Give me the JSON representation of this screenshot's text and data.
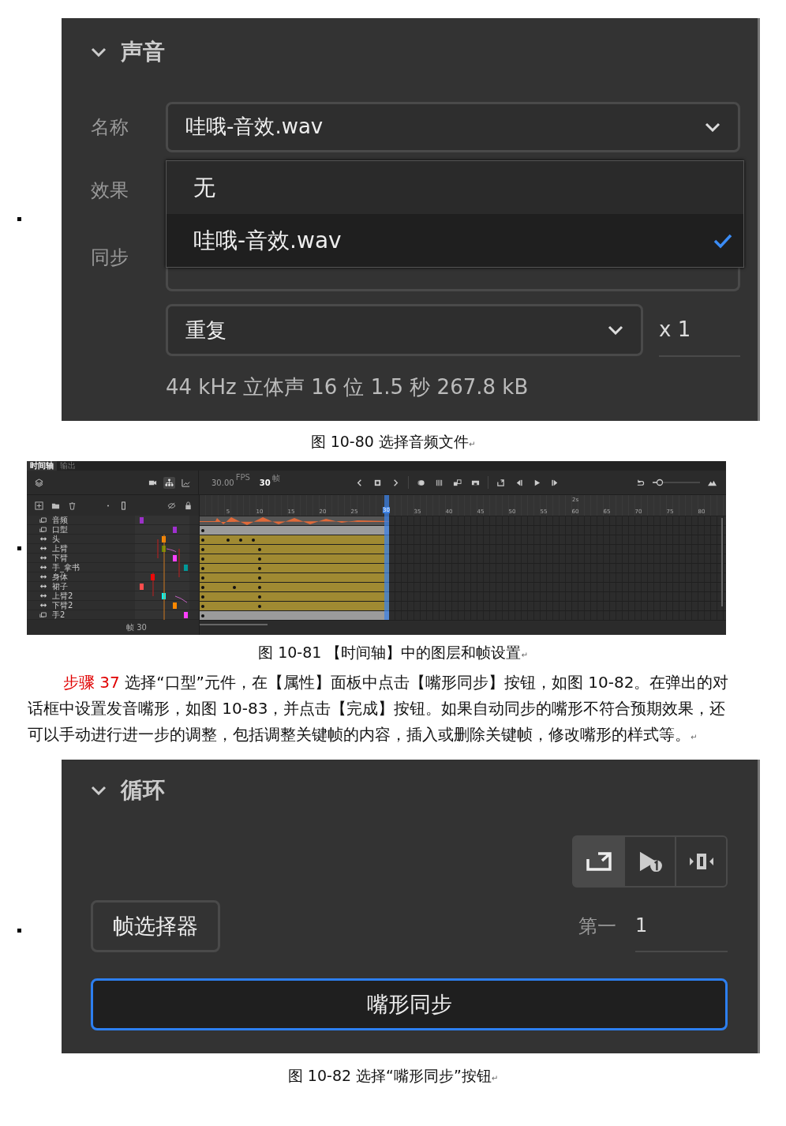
{
  "sound_panel": {
    "title": "声音",
    "name_label": "名称",
    "name_value": "哇哦-音效.wav",
    "effect_label": "效果",
    "sync_label": "同步",
    "menu": [
      {
        "label": "无",
        "selected": false
      },
      {
        "label": "哇哦-音效.wav",
        "selected": true
      }
    ],
    "repeat_value": "重复",
    "repeat_count": "x 1",
    "info": "44 kHz 立体声 16 位 1.5 秒 267.8 kB"
  },
  "caption_1": {
    "text": "图  10-80  选择音频文件",
    "mark": "↵"
  },
  "timeline": {
    "tabs": [
      {
        "label": "时间轴",
        "selected": true
      },
      {
        "label": "输出",
        "selected": false
      }
    ],
    "fps": "30.00",
    "fps_unit": "FPS",
    "frame": "30",
    "frame_unit": "帧",
    "ruler": [
      "5",
      "10",
      "15",
      "20",
      "25",
      "35",
      "40",
      "45",
      "50",
      "55",
      "60",
      "65",
      "70",
      "75",
      "80"
    ],
    "ruler_seconds": "2s",
    "playhead_label": "30",
    "zoom": {
      "level": 0.15
    },
    "layers": [
      {
        "name": "音频",
        "kind": "audio",
        "color": "#9b30c8"
      },
      {
        "name": "口型",
        "kind": "graphic",
        "color": "#a030d0"
      },
      {
        "name": "头",
        "kind": "bone",
        "color": "#ff8800"
      },
      {
        "name": "上臂",
        "kind": "bone",
        "color": "#6a8a00"
      },
      {
        "name": "下臂",
        "kind": "bone",
        "color": "#ff40ff"
      },
      {
        "name": "手_拿书",
        "kind": "bone",
        "color": "#009999"
      },
      {
        "name": "身体",
        "kind": "bone",
        "color": "#ff0000"
      },
      {
        "name": "裙子",
        "kind": "bone",
        "color": "#ff4d4d"
      },
      {
        "name": "上臂2",
        "kind": "bone",
        "color": "#00ffff"
      },
      {
        "name": "下臂2",
        "kind": "bone",
        "color": "#ff8800"
      },
      {
        "name": "手2",
        "kind": "graphic",
        "color": "#ff40ff"
      }
    ],
    "footer": "帧 30"
  },
  "caption_2": {
    "text": "图  10-81  【时间轴】中的图层和帧设置",
    "mark": "↵"
  },
  "paragraph": {
    "step": "步骤 37",
    "text": " 选择“口型”元件，在【属性】面板中点击【嘴形同步】按钮，如图 10-82。在弹出的对话框中设置发音嘴形，如图 10-83，并点击【完成】按钮。如果自动同步的嘴形不符合预期效果，还可以手动进行进一步的调整，包括调整关键帧的内容，插入或删除关键帧，修改嘴形的样式等。",
    "mark": "↵"
  },
  "loop_panel": {
    "title": "循环",
    "modes": [
      {
        "kind": "loop",
        "selected": true
      },
      {
        "kind": "play-once",
        "selected": false
      },
      {
        "kind": "single-frame",
        "selected": false
      }
    ],
    "frame_picker": "帧选择器",
    "first_label": "第一",
    "first_value": "1",
    "lip_sync": "嘴形同步"
  },
  "caption_3": {
    "text": "图  10-82  选择“嘴形同步”按钮",
    "mark": "↵"
  }
}
